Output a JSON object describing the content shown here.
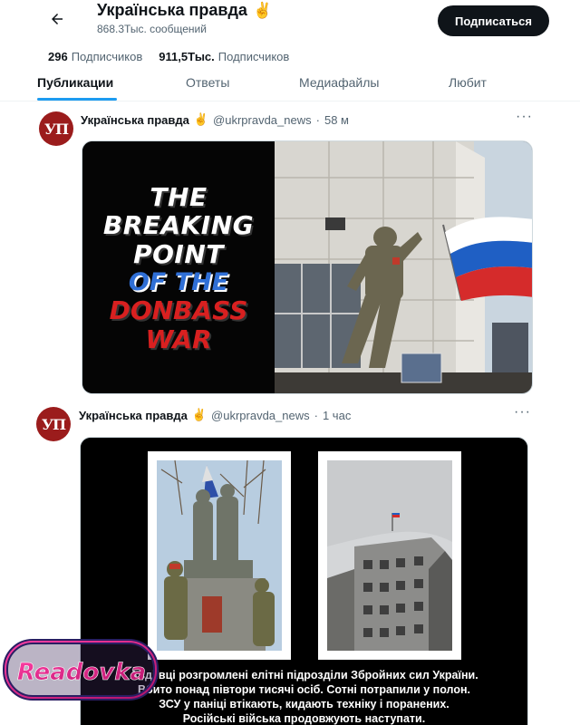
{
  "header": {
    "account_name": "Українська правда",
    "account_emoji": "✌️",
    "posts_count": "868.3Тыс. сообщений",
    "subscribe_label": "Подписаться",
    "back_icon": "arrow-left-icon"
  },
  "stats": {
    "following_value": "296",
    "following_label": "Подписчиков",
    "followers_value": "911,5Тыс.",
    "followers_label": "Подписчиков"
  },
  "tabs": [
    {
      "label": "Публикации",
      "active": true
    },
    {
      "label": "Ответы",
      "active": false
    },
    {
      "label": "Медиафайлы",
      "active": false
    },
    {
      "label": "Любит",
      "active": false
    }
  ],
  "posts": [
    {
      "avatar_text": "УП",
      "name": "Українська правда",
      "emoji": "✌️",
      "handle": "@ukrpravda_news",
      "separator": "·",
      "time": "58 м",
      "more": "···",
      "image_lines": [
        {
          "text": "THE",
          "style": "white"
        },
        {
          "text": "BREAKING",
          "style": "white"
        },
        {
          "text": "POINT",
          "style": "white"
        },
        {
          "text": "OF THE",
          "style": "blue"
        },
        {
          "text": "DONBASS",
          "style": "red"
        },
        {
          "text": "WAR",
          "style": "red"
        }
      ]
    },
    {
      "avatar_text": "УП",
      "name": "Українська правда",
      "emoji": "✌️",
      "handle": "@ukrpravda_news",
      "separator": "·",
      "time": "1 час",
      "more": "···",
      "caption_lines": [
        "Авдіївці розгромлені елітні підрозділи Збройних сил України.",
        "Вбито понад півтори тисячі осіб. Сотні потрапили у полон.",
        "ЗСУ у паніці втікають, кидають техніку і поранених.",
        "Російські війська продовжують наступати."
      ]
    }
  ],
  "watermark": {
    "text": "Readovka"
  },
  "colors": {
    "accent": "#1d9bf0",
    "button_bg": "#0f1419",
    "avatar_bg": "#9b1c1c",
    "muted_text": "#536471",
    "watermark_pink": "#e8207c"
  }
}
